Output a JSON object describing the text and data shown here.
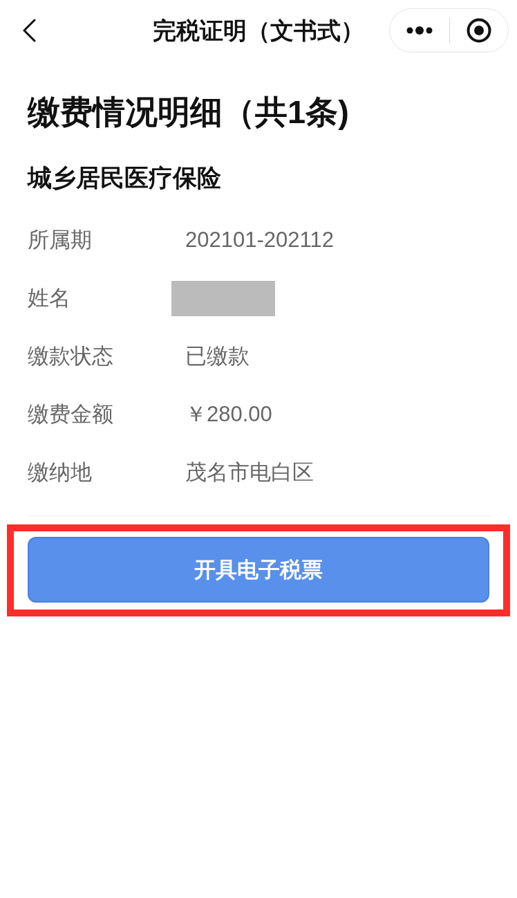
{
  "nav_bar": {
    "title": "完税证明（文书式）"
  },
  "heading": "缴费情况明细（共1条)",
  "record": {
    "title": "城乡居民医疗保险",
    "fields": [
      {
        "label": "所属期",
        "kind": "text",
        "value": "202101-202112"
      },
      {
        "label": "姓名",
        "kind": "redacted"
      },
      {
        "label": "缴款状态",
        "kind": "text",
        "value": "已缴款"
      },
      {
        "label": "缴费金额",
        "kind": "text",
        "value": "￥280.00"
      },
      {
        "label": "缴纳地",
        "kind": "text",
        "value": "茂名市电白区"
      }
    ]
  },
  "action_button": {
    "label": "开具电子税票",
    "highlighted": true
  }
}
